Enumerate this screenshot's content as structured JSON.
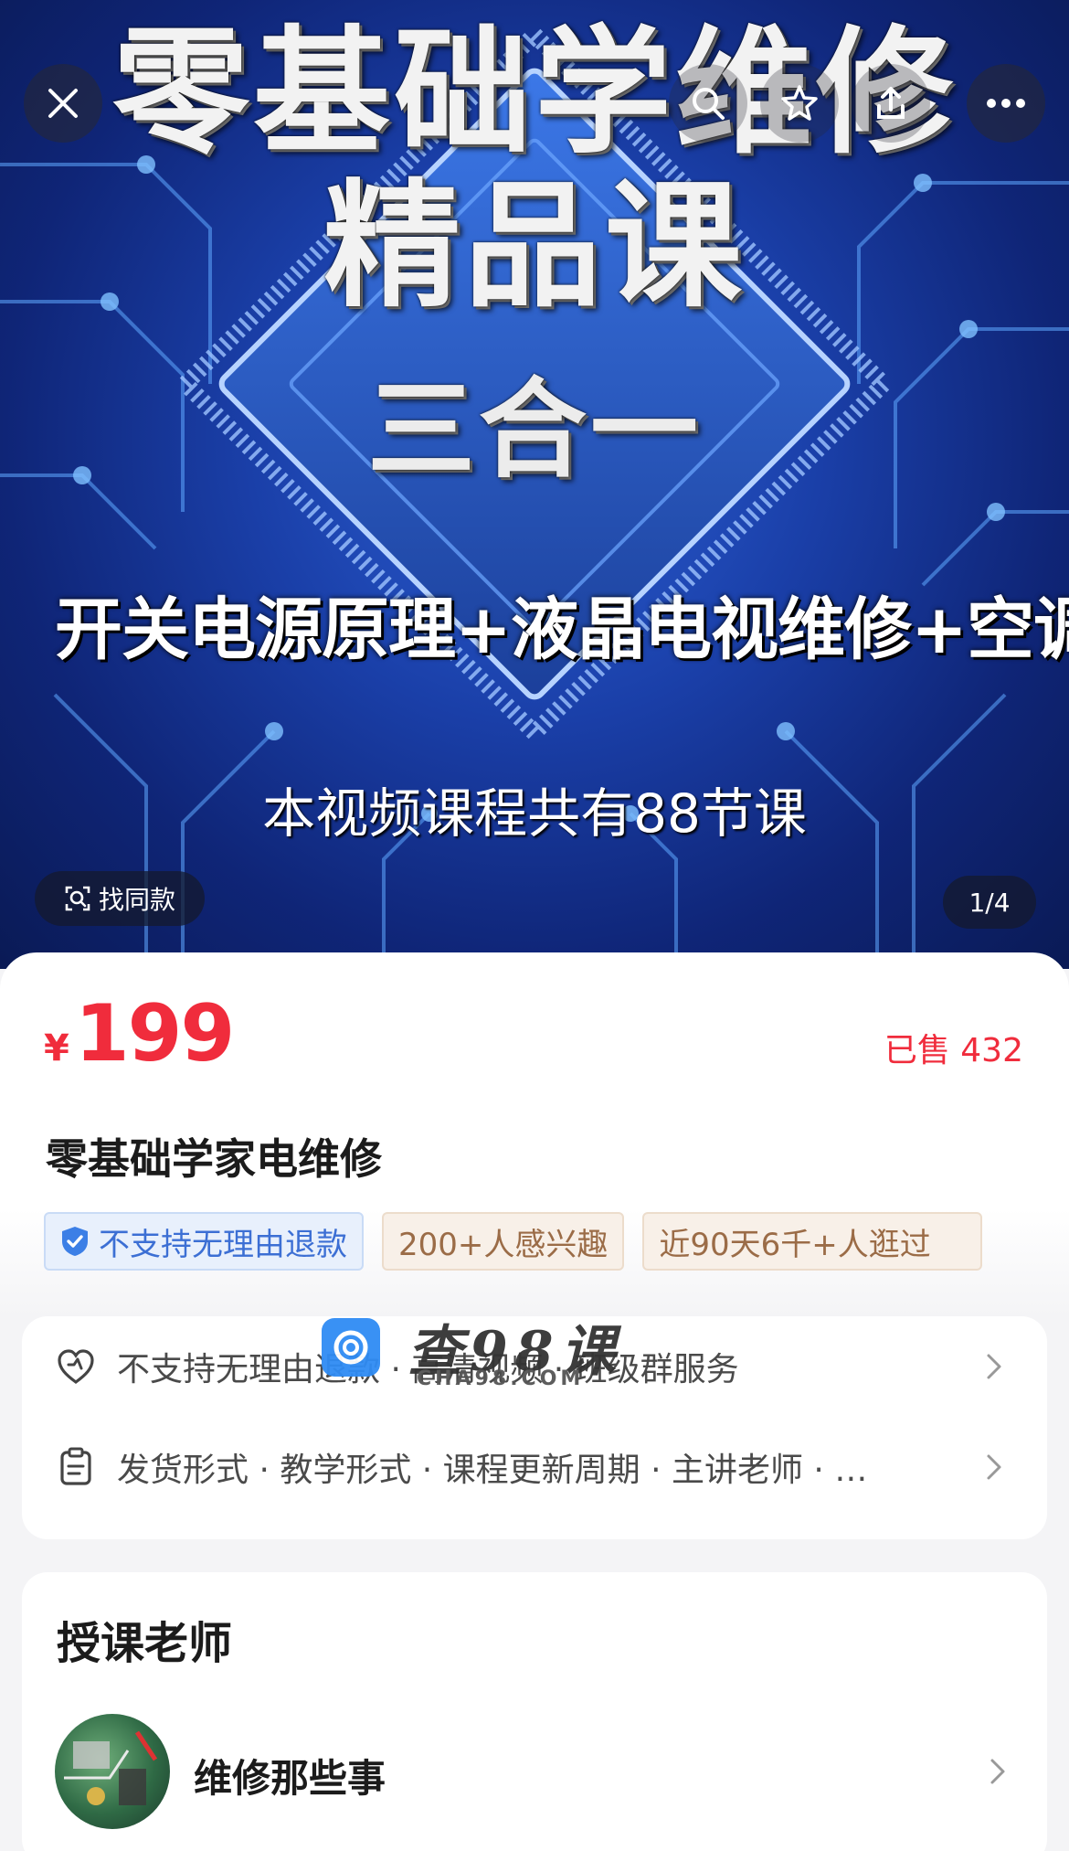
{
  "hero": {
    "title_line1": "零基础学维修",
    "title_line2": "精品课",
    "title_line3": "三合一",
    "subtitle": "开关电源原理+液晶电视维修+空调维修",
    "lesson_count_text": "本视频课程共有88节课",
    "find_same_label": "找同款",
    "pager": "1/4",
    "icons": [
      "close-icon",
      "search-icon",
      "star-icon",
      "share-icon",
      "more-icon"
    ]
  },
  "product": {
    "currency": "¥",
    "price": "199",
    "sold": "已售 432",
    "title": "零基础学家电维修",
    "tags": [
      "不支持无理由退款",
      "200+人感兴趣",
      "近90天6千+人逛过"
    ]
  },
  "services": {
    "row1": "不支持无理由退款 · 高清视频 · 班级群服务",
    "row2": "发货形式 · 教学形式 · 课程更新周期 · 主讲老师 · …"
  },
  "watermark": {
    "text": "查98课",
    "sub": "CHA98.COM"
  },
  "teacher": {
    "section_title": "授课老师",
    "name": "维修那些事"
  },
  "colors": {
    "price_red": "#f02c3c",
    "tag_blue": "#3c6fd4",
    "tag_brown": "#9b6c47",
    "hero_blue": "#1a3fa8"
  }
}
